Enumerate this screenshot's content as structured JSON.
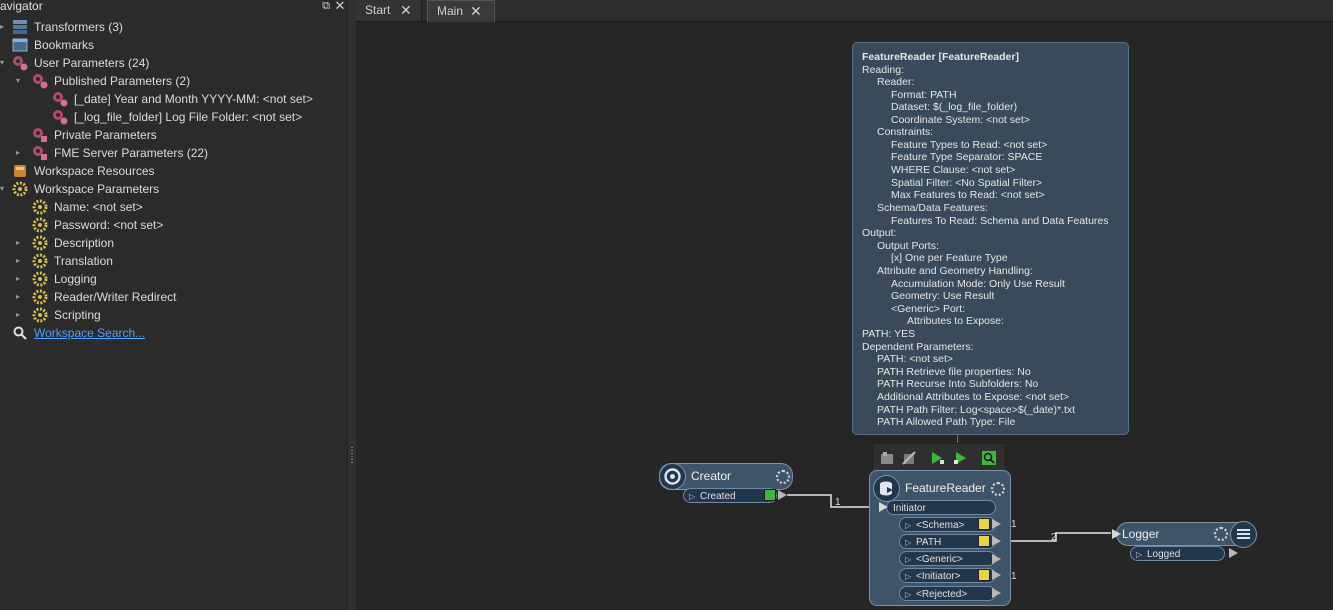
{
  "navigator": {
    "title": "avigator",
    "items": [
      {
        "label": "Transformers (3)"
      },
      {
        "label": "Bookmarks"
      },
      {
        "label": "User Parameters (24)"
      },
      {
        "label": "Published Parameters (2)"
      },
      {
        "label": "[_date] Year and Month YYYY-MM: <not set>"
      },
      {
        "label": "[_log_file_folder] Log File Folder: <not set>"
      },
      {
        "label": "Private Parameters"
      },
      {
        "label": "FME Server Parameters (22)"
      },
      {
        "label": "Workspace Resources"
      },
      {
        "label": "Workspace Parameters"
      },
      {
        "label": "Name: <not set>"
      },
      {
        "label": "Password: <not set>"
      },
      {
        "label": "Description"
      },
      {
        "label": "Translation"
      },
      {
        "label": "Logging"
      },
      {
        "label": "Reader/Writer Redirect"
      },
      {
        "label": "Scripting"
      },
      {
        "label": "Workspace Search..."
      }
    ]
  },
  "tabs": [
    {
      "label": "Start"
    },
    {
      "label": "Main"
    }
  ],
  "tooltip": {
    "title": "FeatureReader [FeatureReader]",
    "lines": [
      "Reading:",
      "Reader:",
      "Format: PATH",
      "Dataset: $(_log_file_folder)",
      "Coordinate System: <not set>",
      "Constraints:",
      "Feature Types to Read: <not set>",
      "Feature Type Separator: SPACE",
      "WHERE Clause: <not set>",
      "Spatial Filter: <No Spatial Filter>",
      "Max Features to Read: <not set>",
      "Schema/Data Features:",
      "Features To Read: Schema and Data Features",
      "Output:",
      "Output Ports:",
      "[x] One per Feature Type",
      "Attribute and Geometry Handling:",
      "Accumulation Mode: Only Use Result",
      "Geometry: Use Result",
      "<Generic> Port:",
      "Attributes to Expose:",
      "PATH: YES",
      "Dependent Parameters:",
      "PATH: <not set>",
      "PATH Retrieve file properties: No",
      "PATH Recurse Into Subfolders: No",
      "Additional Attributes to Expose: <not set>",
      "PATH Path Filter: Log<space>$(_date)*.txt",
      "PATH Allowed Path Type: File"
    ]
  },
  "creator": {
    "name": "Creator",
    "output": "Created"
  },
  "featurereader": {
    "name": "FeatureReader",
    "input": "Initiator",
    "outputs": [
      "<Schema>",
      "PATH",
      "<Generic>",
      "<Initiator>",
      "<Rejected>"
    ]
  },
  "logger": {
    "name": "Logger",
    "output": "Logged"
  },
  "connections": {
    "creator_to_reader": "1",
    "path_to_logger": "2",
    "schema_count": "1",
    "initiator_count": "1"
  },
  "colors": {
    "node_fill": "#3f5369",
    "node_border": "#7b93ad",
    "port_fill": "#24364b",
    "tooltip_bg": "#3a4a5a",
    "link": "#4aa3ff",
    "inspect_green": "#3db83d",
    "inspect_yellow": "#e8d44a"
  }
}
